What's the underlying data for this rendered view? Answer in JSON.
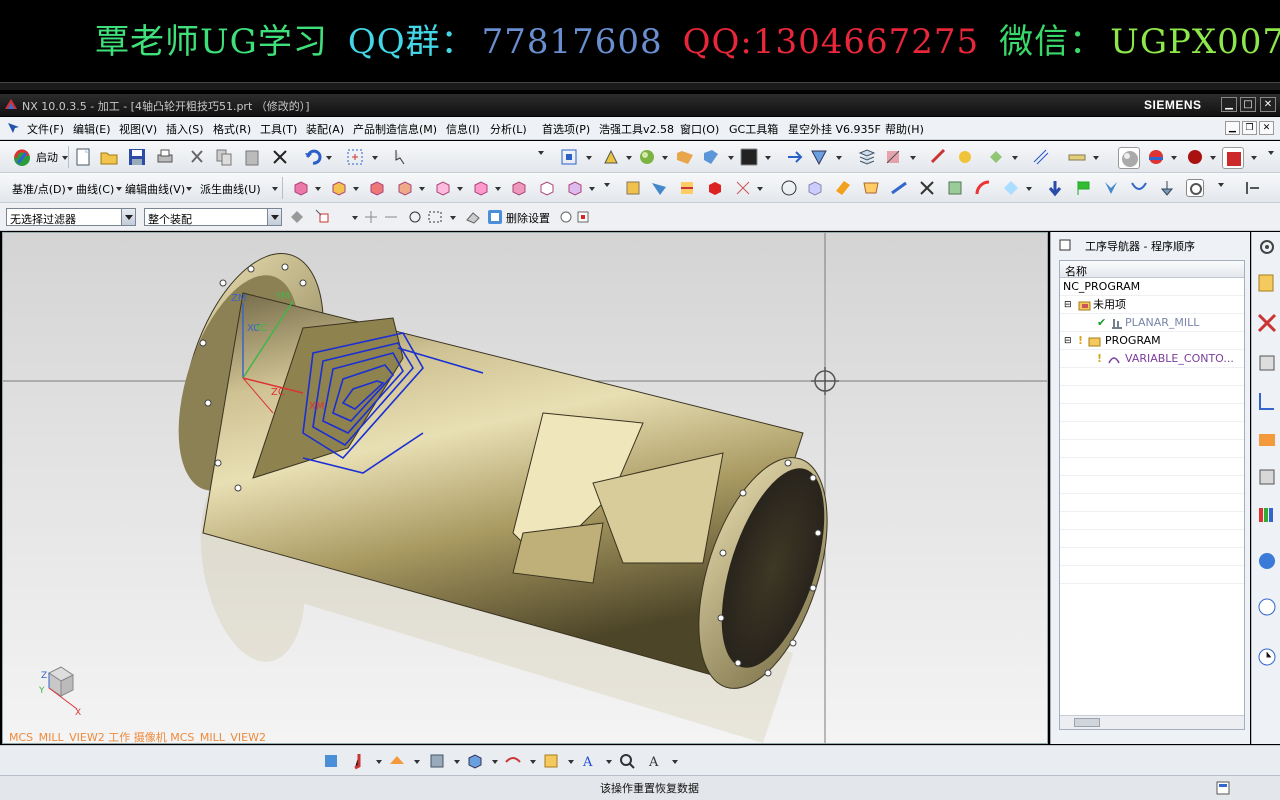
{
  "banner": {
    "part1": "覃老师UG学习",
    "part2": "QQ群：",
    "part3": "77817608",
    "part4": "QQ:1304667275",
    "part5": "微信：",
    "part6": "UGPX007"
  },
  "window": {
    "title": "NX 10.0.3.5 - 加工 - [4轴凸轮开粗技巧51.prt （修改的）]",
    "brand": "SIEMENS"
  },
  "menu": {
    "items": [
      "文件(F)",
      "编辑(E)",
      "视图(V)",
      "插入(S)",
      "格式(R)",
      "工具(T)",
      "装配(A)",
      "产品制造信息(M)",
      "信息(I)",
      "分析(L)",
      "首选项(P)",
      "浩强工具v2.58",
      "窗口(O)",
      "GC工具箱",
      "星空外挂 V6.935F",
      "帮助(H)"
    ]
  },
  "toolbar1": {
    "start_label": "启动"
  },
  "toolbar2": {
    "labels": [
      "基准/点(D)",
      "曲线(C)",
      "编辑曲线(V)",
      "派生曲线(U)"
    ]
  },
  "toolbar3": {
    "filter_value": "无选择过滤器",
    "scope_value": "整个装配",
    "delete_setting": "删除设置"
  },
  "viewport": {
    "caption": "MCS_MILL_VIEW2 工作 摄像机 MCS_MILL_VIEW2",
    "csys_labels": [
      "ZM",
      "YM",
      "XC",
      "YC",
      "ZC",
      "XM"
    ]
  },
  "navigator": {
    "title": "工序导航器 - 程序顺序",
    "column_header": "名称",
    "rows": [
      "NC_PROGRAM",
      "未用项",
      "PLANAR_MILL",
      "PROGRAM",
      "VARIABLE_CONTO..."
    ]
  },
  "status": {
    "message": "该操作重置恢复数据"
  },
  "colors": {
    "part_gold": "#b8a76a",
    "toolpath_blue": "#1a2fd4",
    "caption_orange": "#ee8a3c"
  }
}
